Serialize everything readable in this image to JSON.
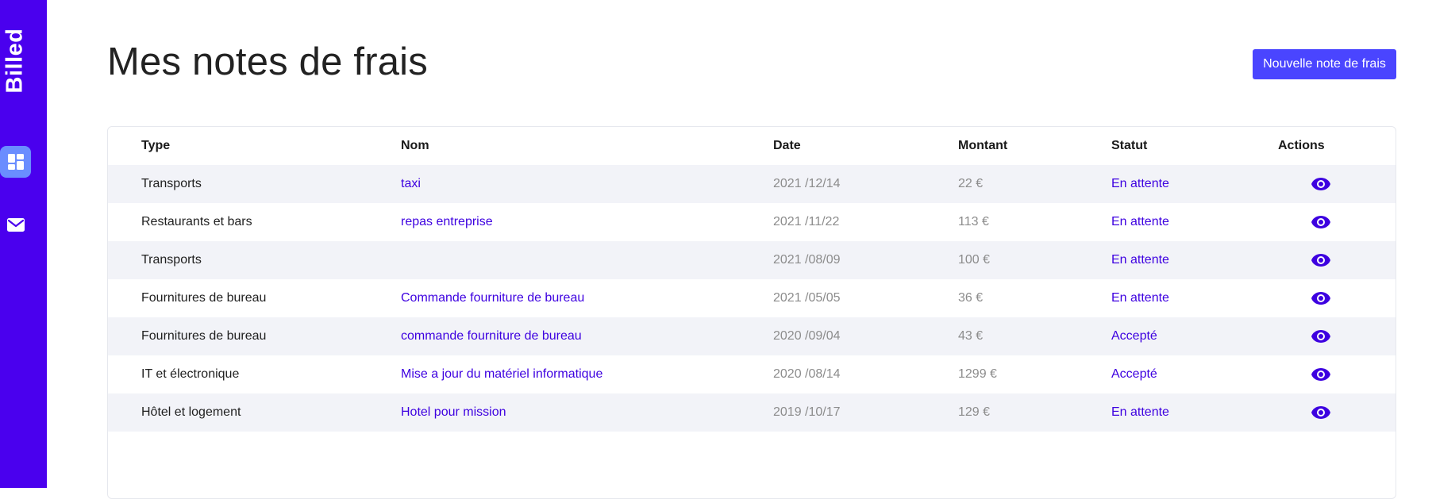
{
  "app": {
    "brand": "Billed"
  },
  "sidebar": {
    "items": [
      {
        "icon": "dashboard-icon",
        "active": true
      },
      {
        "icon": "mail-icon",
        "active": false
      }
    ]
  },
  "page": {
    "title": "Mes notes de frais",
    "new_button_label": "Nouvelle note de frais"
  },
  "table": {
    "headers": {
      "type": "Type",
      "nom": "Nom",
      "date": "Date",
      "montant": "Montant",
      "statut": "Statut",
      "actions": "Actions"
    },
    "rows": [
      {
        "type": "Transports",
        "nom": "taxi",
        "date": "2021 /12/14",
        "montant": "22 €",
        "statut": "En attente"
      },
      {
        "type": "Restaurants et bars",
        "nom": "repas entreprise",
        "date": "2021 /11/22",
        "montant": "113 €",
        "statut": "En attente"
      },
      {
        "type": "Transports",
        "nom": "",
        "date": "2021 /08/09",
        "montant": "100 €",
        "statut": "En attente"
      },
      {
        "type": "Fournitures de bureau",
        "nom": "Commande fourniture de bureau",
        "date": "2021 /05/05",
        "montant": "36 €",
        "statut": "En attente"
      },
      {
        "type": "Fournitures de bureau",
        "nom": "commande fourniture de bureau",
        "date": "2020 /09/04",
        "montant": "43 €",
        "statut": "Accepté"
      },
      {
        "type": "IT et électronique",
        "nom": "Mise a jour du matériel informatique",
        "date": "2020 /08/14",
        "montant": "1299 €",
        "statut": "Accepté"
      },
      {
        "type": "Hôtel et logement",
        "nom": "Hotel pour mission",
        "date": "2019 /10/17",
        "montant": "129 €",
        "statut": "En attente"
      }
    ],
    "action_icon": "eye-icon"
  },
  "colors": {
    "sidebar": "#4a00ee",
    "accent": "#3d00e0",
    "button": "#4a45ff",
    "active_nav": "#6a8dff",
    "row_alt": "#f2f3f8"
  }
}
